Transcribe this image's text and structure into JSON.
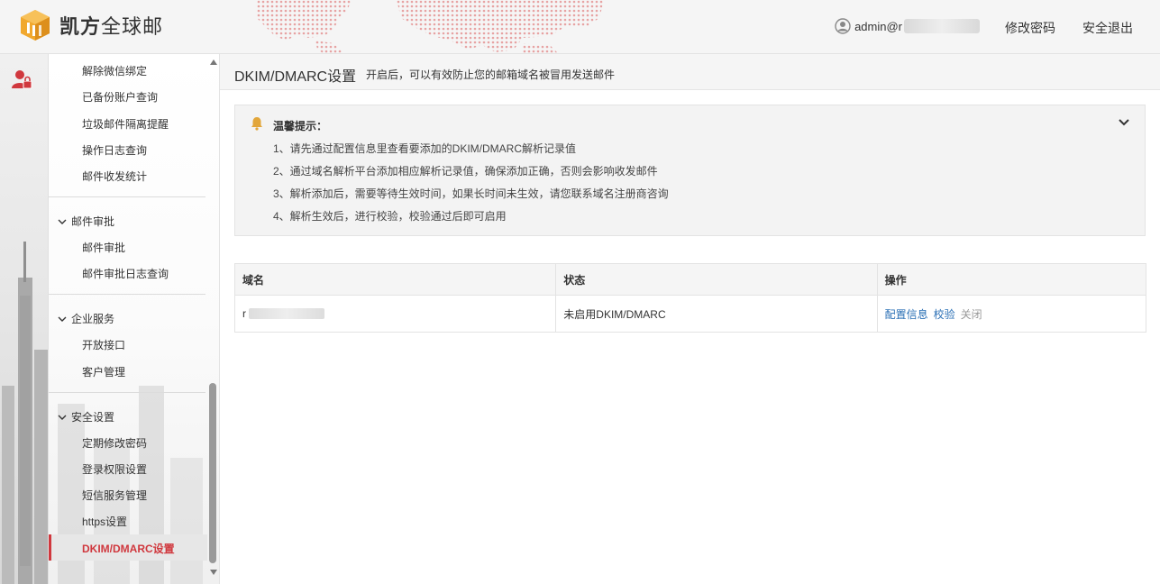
{
  "header": {
    "brand_bold": "凯方",
    "brand_rest": "全球邮",
    "user_prefix": "admin@r",
    "change_password": "修改密码",
    "logout": "安全退出"
  },
  "sidebar": {
    "items_top": [
      {
        "label": "解除微信绑定"
      },
      {
        "label": "已备份账户查询"
      },
      {
        "label": "垃圾邮件隔离提醒"
      },
      {
        "label": "操作日志查询"
      },
      {
        "label": "邮件收发统计"
      }
    ],
    "group_approval": {
      "label": "邮件审批",
      "items": [
        {
          "label": "邮件审批"
        },
        {
          "label": "邮件审批日志查询"
        }
      ]
    },
    "group_enterprise": {
      "label": "企业服务",
      "items": [
        {
          "label": "开放接口"
        },
        {
          "label": "客户管理"
        }
      ]
    },
    "group_security": {
      "label": "安全设置",
      "items": [
        {
          "label": "定期修改密码"
        },
        {
          "label": "登录权限设置"
        },
        {
          "label": "短信服务管理"
        },
        {
          "label": "https设置"
        }
      ]
    },
    "active_item": "DKIM/DMARC设置"
  },
  "page": {
    "title": "DKIM/DMARC设置",
    "subtitle": "开启后，可以有效防止您的邮箱域名被冒用发送邮件"
  },
  "notice": {
    "title": "温馨提示：",
    "lines": [
      "1、请先通过配置信息里查看要添加的DKIM/DMARC解析记录值",
      "2、通过域名解析平台添加相应解析记录值，确保添加正确，否则会影响收发邮件",
      "3、解析添加后，需要等待生效时间，如果长时间未生效，请您联系域名注册商咨询",
      "4、解析生效后，进行校验，校验通过后即可启用"
    ]
  },
  "table": {
    "headers": [
      "域名",
      "状态",
      "操作"
    ],
    "rows": [
      {
        "domain_prefix": "r",
        "status": "未启用DKIM/DMARC",
        "actions": {
          "config": "配置信息",
          "verify": "校验",
          "close": "关闭"
        }
      }
    ]
  },
  "colors": {
    "accent": "#d0383e",
    "link": "#2a6fb5"
  }
}
